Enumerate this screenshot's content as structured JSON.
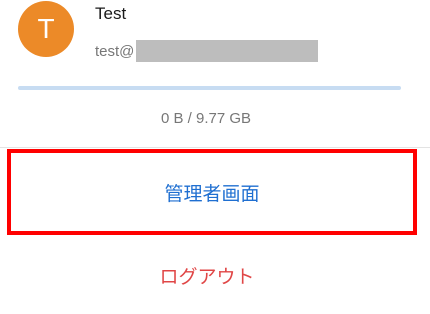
{
  "user": {
    "avatar_initial": "T",
    "avatar_color": "#ec8a28",
    "name": "Test",
    "email_prefix": "test@"
  },
  "storage": {
    "usage_text": "0 B / 9.77 GB",
    "used_fraction": 0,
    "bar_color": "#c7dcf2"
  },
  "menu": {
    "admin_label": "管理者画面",
    "admin_color": "#1f6fd1",
    "highlight_color": "#ff0000",
    "logout_label": "ログアウト",
    "logout_color": "#e04646"
  }
}
